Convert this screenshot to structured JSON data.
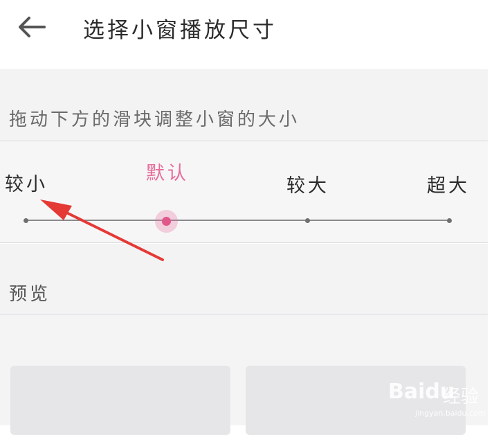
{
  "header": {
    "title": "选择小窗播放尺寸"
  },
  "hint": "拖动下方的滑块调整小窗的大小",
  "slider": {
    "options": [
      "较小",
      "默认",
      "较大",
      "超大"
    ],
    "selected": "默认",
    "accent_color": "#e0578a"
  },
  "preview": {
    "label": "预览"
  },
  "watermark": {
    "brand": "Baidu",
    "brand_cn": "经验",
    "url": "jingyan.baidu.com"
  },
  "icons": [
    "back-arrow-icon"
  ],
  "colors": {
    "accent": "#e76c9a",
    "annotation_arrow": "#e53935"
  }
}
